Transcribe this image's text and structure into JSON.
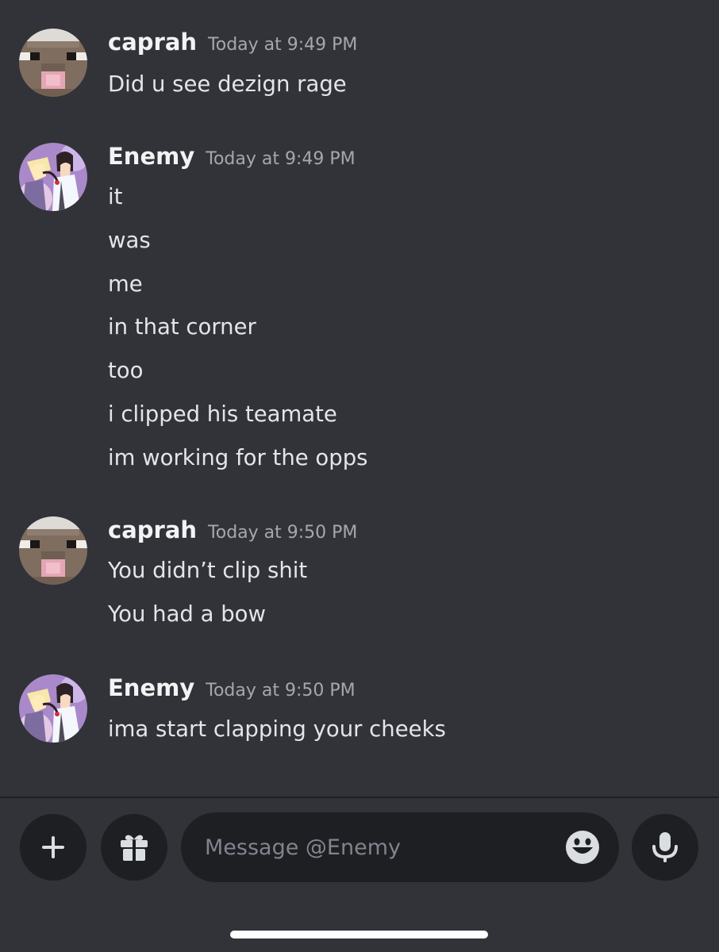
{
  "messages": [
    {
      "author": "caprah",
      "timestamp": "Today at 9:49 PM",
      "avatar": "sheep-avatar",
      "lines": [
        "Did u see dezign rage"
      ]
    },
    {
      "author": "Enemy",
      "timestamp": "Today at 9:49 PM",
      "avatar": "anime-avatar",
      "lines": [
        "it",
        "was",
        "me",
        "in that corner",
        "too",
        "i clipped his teamate",
        "im working for the opps"
      ]
    },
    {
      "author": "caprah",
      "timestamp": "Today at 9:50 PM",
      "avatar": "sheep-avatar",
      "lines": [
        "You didn’t clip shit",
        "You had a bow"
      ]
    },
    {
      "author": "Enemy",
      "timestamp": "Today at 9:50 PM",
      "avatar": "anime-avatar",
      "lines": [
        "ima start clapping your cheeks"
      ]
    }
  ],
  "composer": {
    "placeholder": "Message @Enemy",
    "icons": {
      "add": "plus-icon",
      "gift": "gift-icon",
      "emoji": "emoji-icon",
      "voice": "microphone-icon"
    }
  },
  "colors": {
    "background": "#313338",
    "input_background": "#1e1f22",
    "username": "#f2f3f5",
    "timestamp": "#a4a8ae",
    "message_text": "#e3e5e8"
  }
}
